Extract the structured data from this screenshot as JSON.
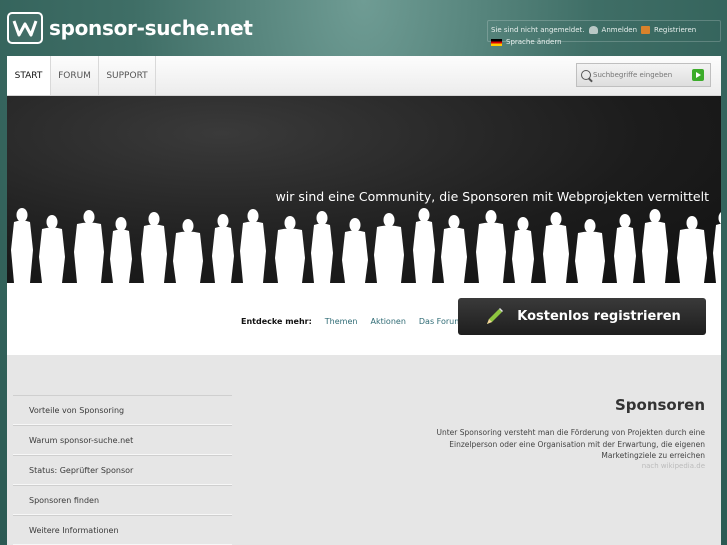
{
  "site": {
    "name": "sponsor-suche.net"
  },
  "topbar": {
    "status_text": "Sie sind nicht angemeldet.",
    "login_label": "Anmelden",
    "register_label": "Registrieren",
    "language_label": "Sprache ändern"
  },
  "nav": {
    "tabs": [
      "START",
      "FORUM",
      "SUPPORT"
    ],
    "active": "START"
  },
  "search": {
    "placeholder": "Suchbegriffe eingeben"
  },
  "banner": {
    "slogan": "wir sind eine Community,  die Sponsoren mit Webprojekten vermittelt"
  },
  "discover": {
    "label": "Entdecke mehr:",
    "links": [
      "Themen",
      "Aktionen",
      "Das Forum"
    ]
  },
  "register_button": {
    "label": "Kostenlos registrieren"
  },
  "sidebar": {
    "items": [
      "Vorteile von Sponsoring",
      "Warum sponsor-suche.net",
      "Status: Geprüfter Sponsor",
      "Sponsoren finden",
      "Weitere Informationen"
    ]
  },
  "main": {
    "title": "Sponsoren",
    "description": "Unter Sponsoring versteht man die Förderung von Projekten durch eine Einzelperson oder eine Organisation mit der Erwartung, die eigenen Marketingziele zu erreichen",
    "source": "nach wikipedia.de"
  },
  "colors": {
    "accent_teal": "#3f6e66",
    "link": "#2f6b75",
    "button_dark": "#2a2a2a",
    "go_green": "#3cac2a"
  },
  "icons": {
    "logo": "w-logo-icon",
    "search": "search-icon",
    "pencil": "pencil-icon"
  }
}
